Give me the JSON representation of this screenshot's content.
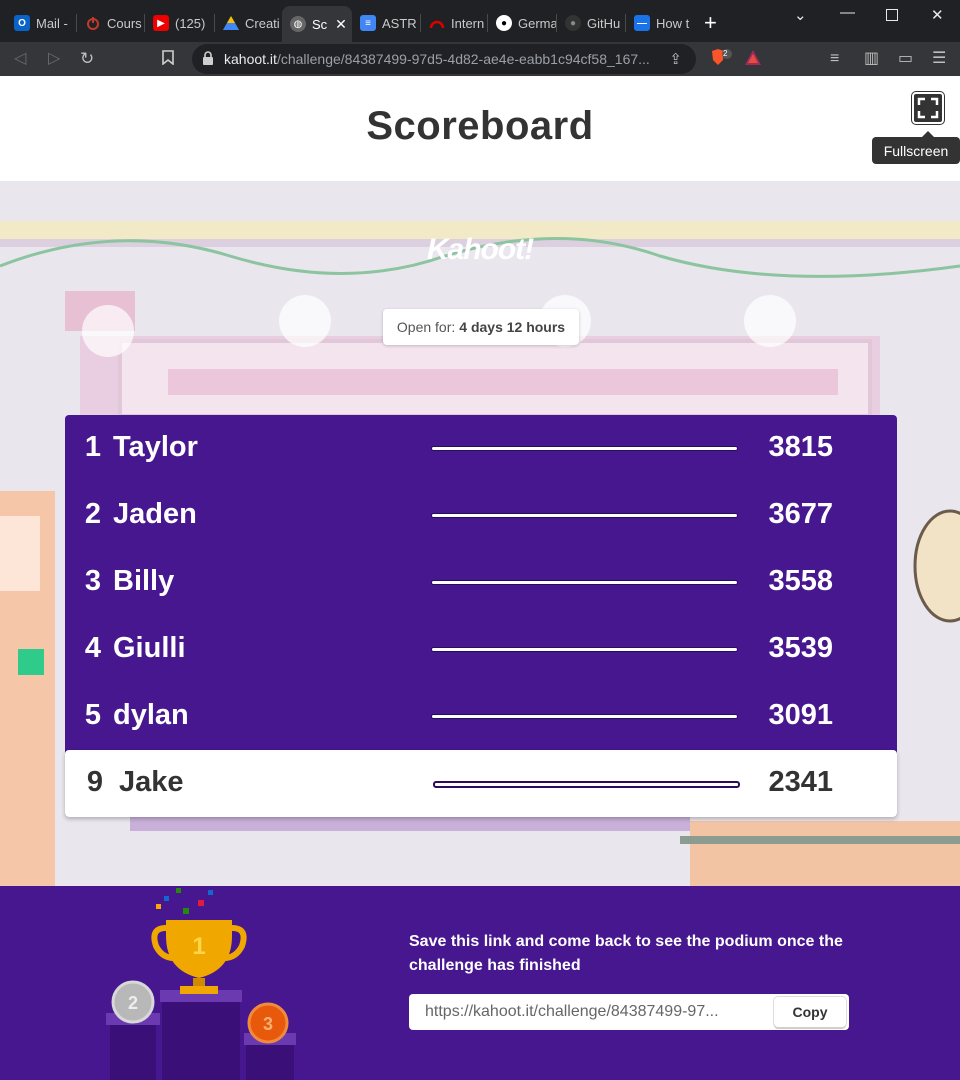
{
  "browser": {
    "tabs": [
      {
        "label": "Mail -",
        "icon": "outlook-icon"
      },
      {
        "label": "Cours",
        "icon": "power-icon"
      },
      {
        "label": "(125)",
        "icon": "youtube-icon"
      },
      {
        "label": "Creati",
        "icon": "drive-icon"
      },
      {
        "label": "Sc",
        "icon": "globe-icon"
      },
      {
        "label": "ASTR",
        "icon": "docs-icon"
      },
      {
        "label": "Intern",
        "icon": "speed-icon"
      },
      {
        "label": "Germa",
        "icon": "github-icon"
      },
      {
        "label": "GitHu",
        "icon": "github-icon"
      },
      {
        "label": "How t",
        "icon": "site-icon"
      }
    ],
    "url_host": "kahoot.it",
    "url_path": "/challenge/84387499-97d5-4d82-ae4e-eabb1c94cf58_167...",
    "shield_count": "2"
  },
  "header": {
    "title": "Scoreboard",
    "fullscreen_tooltip": "Fullscreen"
  },
  "scene": {
    "logo": "Kahoot!",
    "open_label": "Open for:",
    "open_value": "4 days 12 hours"
  },
  "scoreboard": [
    {
      "rank": "1",
      "name": "Taylor",
      "score": "3815"
    },
    {
      "rank": "2",
      "name": "Jaden",
      "score": "3677"
    },
    {
      "rank": "3",
      "name": "Billy",
      "score": "3558"
    },
    {
      "rank": "4",
      "name": "Giulli",
      "score": "3539"
    },
    {
      "rank": "5",
      "name": "dylan",
      "score": "3091"
    }
  ],
  "current_player": {
    "rank": "9",
    "name": "Jake",
    "score": "2341"
  },
  "footer": {
    "save_text": "Save this link and come back to see the podium once the challenge has finished",
    "link_value": "https://kahoot.it/challenge/84387499-97...",
    "copy_label": "Copy",
    "podium": {
      "first": "1",
      "second": "2",
      "third": "3"
    }
  },
  "colors": {
    "brand_purple": "#46178f",
    "tab_bar": "#202124",
    "gold": "#f0a800"
  }
}
